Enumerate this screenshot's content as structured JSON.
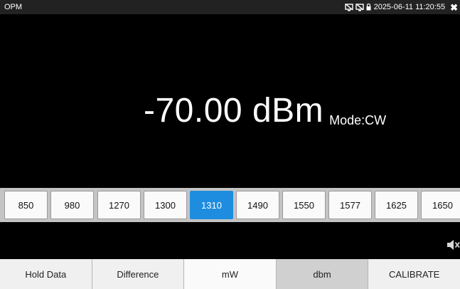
{
  "status_bar": {
    "app_title": "OPM",
    "datetime": "2025-06-11 11:20:55",
    "icons": [
      "screen-off-icon",
      "screen-off-icon",
      "lock-icon"
    ],
    "close_glyph": "✖"
  },
  "reading": {
    "value": "-70.00 dBm",
    "mode": "Mode:CW"
  },
  "wavelengths": {
    "items": [
      "850",
      "980",
      "1270",
      "1300",
      "1310",
      "1490",
      "1550",
      "1577",
      "1625",
      "1650"
    ],
    "selected": "1310"
  },
  "speaker_icon": "speaker-muted-icon",
  "toolbar": {
    "hold_label": "Hold Data",
    "difference_label": "Difference",
    "mw_label": "mW",
    "dbm_label": "dbm",
    "calibrate_label": "CALIBRATE",
    "active": "dbm"
  },
  "colors": {
    "selected_accent": "#1e8de0",
    "background": "#000000"
  }
}
